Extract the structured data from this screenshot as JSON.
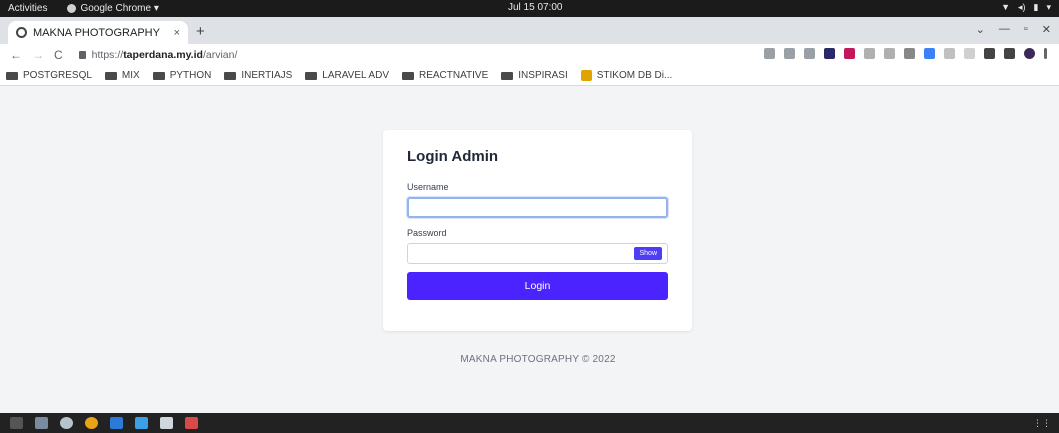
{
  "system": {
    "activities": "Activities",
    "app_name": "Google Chrome ▾",
    "clock": "Jul 15 07:00"
  },
  "browser": {
    "tab_title": "MAKNA PHOTOGRAPHY",
    "tab_close": "×",
    "new_tab": "+",
    "url_scheme": "https://",
    "url_host": "taperdana.my.id",
    "url_path": "/arvian/"
  },
  "bookmarks": [
    {
      "label": "POSTGRESQL",
      "icon": "folder-icon"
    },
    {
      "label": "MIX",
      "icon": "folder-icon"
    },
    {
      "label": "PYTHON",
      "icon": "folder-icon"
    },
    {
      "label": "INERTIAJS",
      "icon": "folder-icon"
    },
    {
      "label": "LARAVEL ADV",
      "icon": "folder-icon"
    },
    {
      "label": "REACTNATIVE",
      "icon": "folder-icon"
    },
    {
      "label": "INSPIRASI",
      "icon": "folder-icon"
    },
    {
      "label": "STIKOM DB Di...",
      "icon": "bookmark-icon"
    }
  ],
  "login": {
    "title": "Login Admin",
    "username_label": "Username",
    "username_value": "",
    "password_label": "Password",
    "password_value": "",
    "show_label": "Show",
    "submit_label": "Login"
  },
  "footer": "MAKNA PHOTOGRAPHY © 2022",
  "colors": {
    "accent": "#4a23ff",
    "page_bg": "#f3f4f6",
    "card_bg": "#ffffff"
  }
}
